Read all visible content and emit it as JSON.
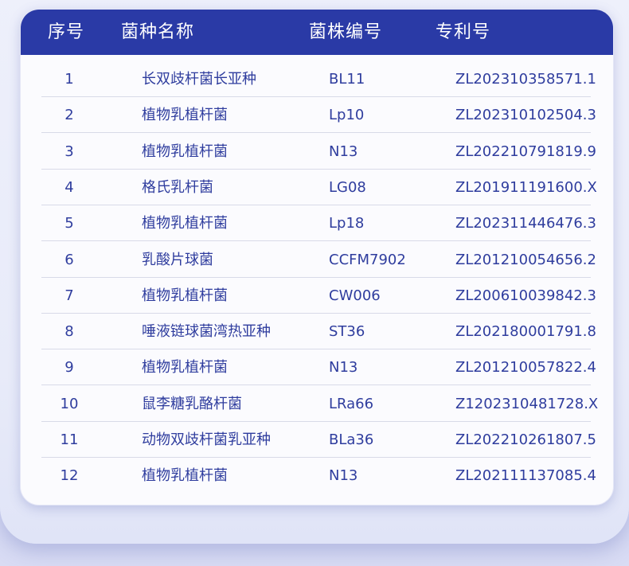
{
  "table": {
    "headers": {
      "no": "序号",
      "species": "菌种名称",
      "strain": "菌株编号",
      "patent": "专利号"
    },
    "rows": [
      {
        "no": "1",
        "species": "长双歧杆菌长亚种",
        "strain": "BL11",
        "patent": "ZL202310358571.1"
      },
      {
        "no": "2",
        "species": "植物乳植杆菌",
        "strain": "Lp10",
        "patent": "ZL202310102504.3"
      },
      {
        "no": "3",
        "species": "植物乳植杆菌",
        "strain": "N13",
        "patent": "ZL202210791819.9"
      },
      {
        "no": "4",
        "species": "格氏乳杆菌",
        "strain": "LG08",
        "patent": "ZL201911191600.X"
      },
      {
        "no": "5",
        "species": "植物乳植杆菌",
        "strain": "Lp18",
        "patent": "ZL202311446476.3"
      },
      {
        "no": "6",
        "species": "乳酸片球菌",
        "strain": "CCFM7902",
        "patent": "ZL201210054656.2"
      },
      {
        "no": "7",
        "species": "植物乳植杆菌",
        "strain": "CW006",
        "patent": "ZL200610039842.3"
      },
      {
        "no": "8",
        "species": "唾液链球菌湾热亚种",
        "strain": "ST36",
        "patent": "ZL202180001791.8"
      },
      {
        "no": "9",
        "species": "植物乳植杆菌",
        "strain": "N13",
        "patent": "ZL201210057822.4"
      },
      {
        "no": "10",
        "species": "鼠李糖乳酪杆菌",
        "strain": "LRa66",
        "patent": "Z1202310481728.X"
      },
      {
        "no": "11",
        "species": "动物双歧杆菌乳亚种",
        "strain": "BLa36",
        "patent": "ZL202210261807.5"
      },
      {
        "no": "12",
        "species": "植物乳植杆菌",
        "strain": "N13",
        "patent": "ZL202111137085.4"
      }
    ]
  },
  "colors": {
    "header_bg": "#2a3aa6",
    "header_text": "#ffffff",
    "cell_text": "#2f3d9e",
    "divider": "#d8dae8",
    "card_bg": "#fbfbfe"
  }
}
